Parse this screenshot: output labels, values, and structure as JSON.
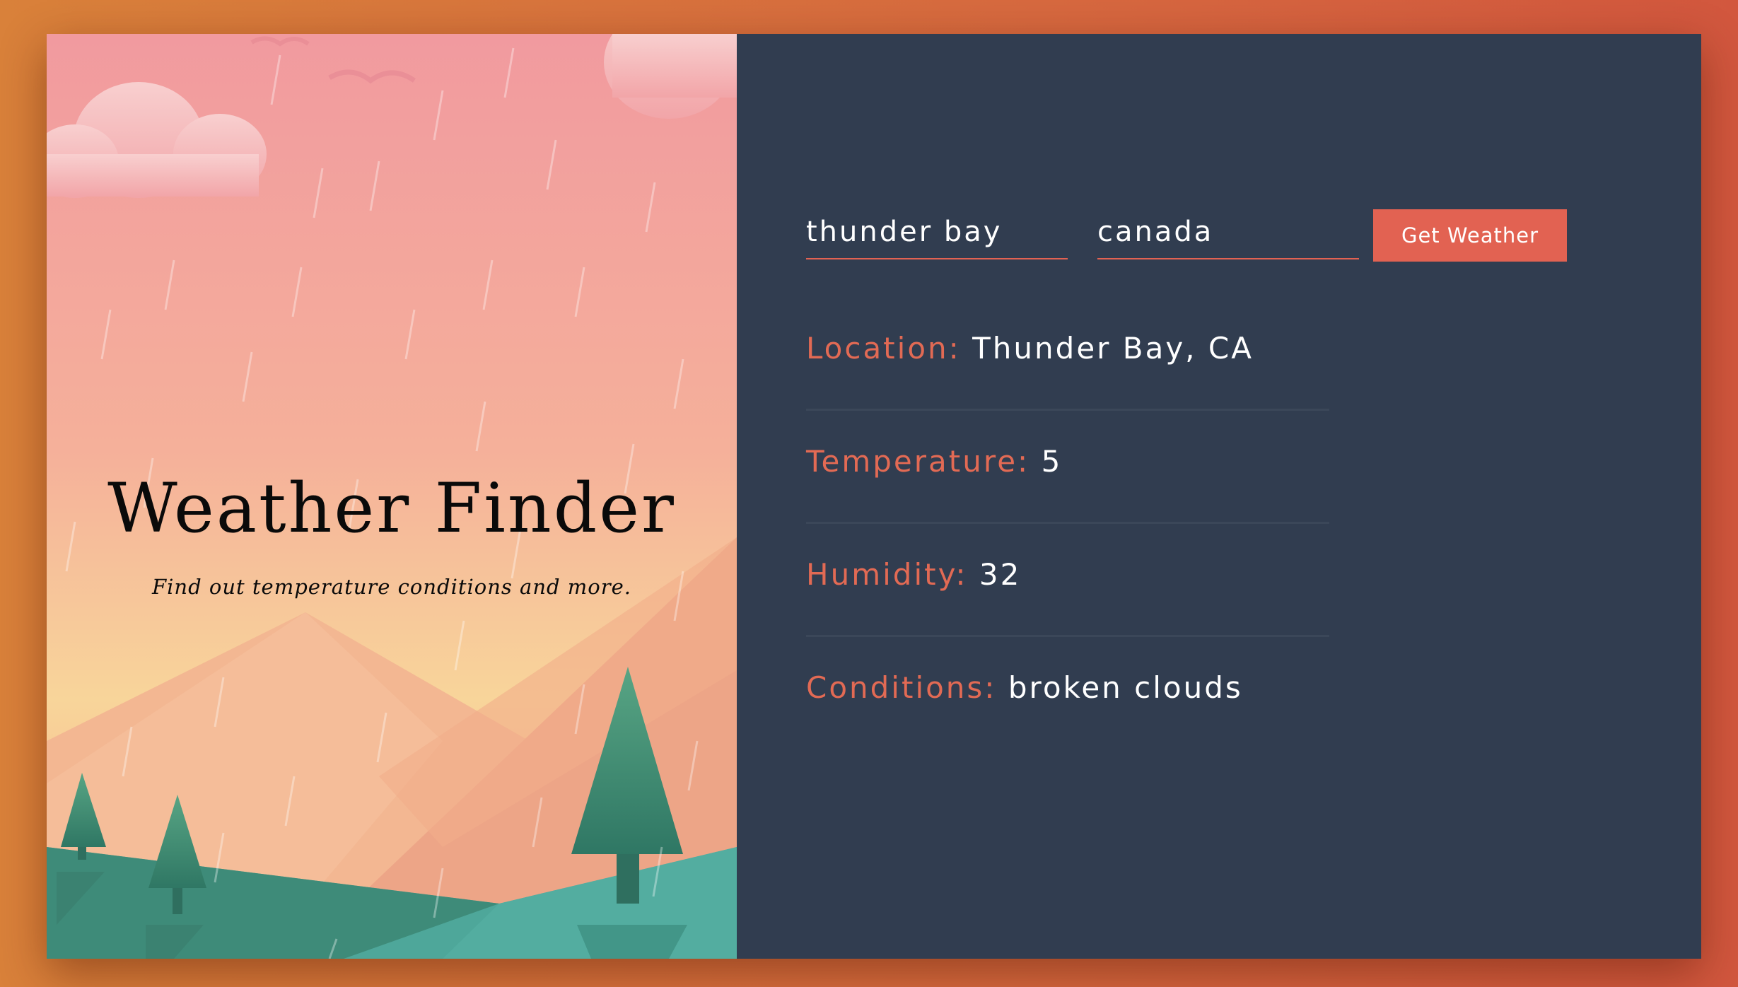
{
  "hero": {
    "title": "Weather Finder",
    "subtitle": "Find out temperature conditions and more."
  },
  "form": {
    "city_value": "thunder bay",
    "country_value": "canada",
    "submit_label": "Get Weather"
  },
  "results": {
    "location_label": "Location:",
    "location_value": "Thunder Bay, CA",
    "temperature_label": "Temperature:",
    "temperature_value": "5",
    "humidity_label": "Humidity:",
    "humidity_value": "32",
    "conditions_label": "Conditions:",
    "conditions_value": "broken clouds"
  },
  "colors": {
    "accent": "#e26252",
    "panel_bg": "#313d50",
    "page_bg": "#d9813a"
  }
}
